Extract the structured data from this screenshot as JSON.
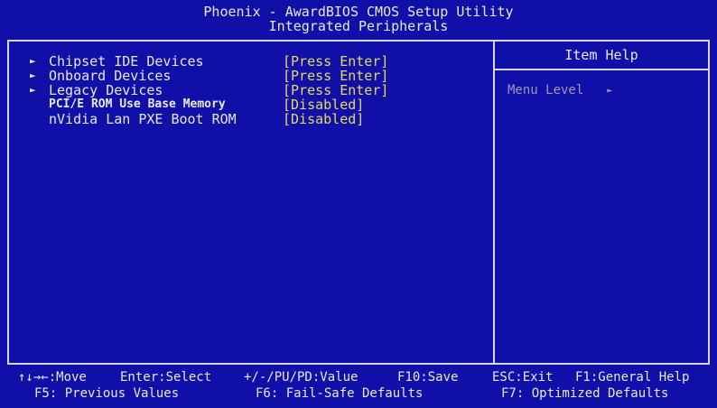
{
  "header": {
    "title_line1": "Phoenix - AwardBIOS CMOS Setup Utility",
    "title_line2": "Integrated Peripherals"
  },
  "menu": {
    "items": [
      {
        "label": "Chipset IDE Devices",
        "value_open": "[",
        "value": "Press Enter",
        "value_close": "]",
        "submenu": true,
        "selected": true
      },
      {
        "label": "Onboard Devices",
        "value": "[Press Enter]",
        "submenu": true,
        "selected": false
      },
      {
        "label": "Legacy Devices",
        "value": "[Press Enter]",
        "submenu": true,
        "selected": false
      },
      {
        "label": "PCI/E ROM Use Base Memory",
        "value": "[Disabled]",
        "submenu": false,
        "selected": false
      },
      {
        "label": "nVidia Lan PXE Boot ROM",
        "value": "[Disabled]",
        "submenu": false,
        "selected": false
      }
    ]
  },
  "help": {
    "title": "Item Help",
    "menu_level_label": "Menu Level",
    "menu_level_marker": "►"
  },
  "footer": {
    "move": "↑↓→←:Move",
    "enter": "Enter:Select",
    "value": "+/-/PU/PD:Value",
    "save": "F10:Save",
    "exit": "ESC:Exit",
    "help": "F1:General Help",
    "f5": "F5: Previous Values",
    "f6": "F6: Fail-Safe Defaults",
    "f7": "F7: Optimized Defaults"
  },
  "colors": {
    "background": "#1010a8",
    "text": "#e8e8e8",
    "value": "#e8d860",
    "highlight": "#c81818"
  }
}
